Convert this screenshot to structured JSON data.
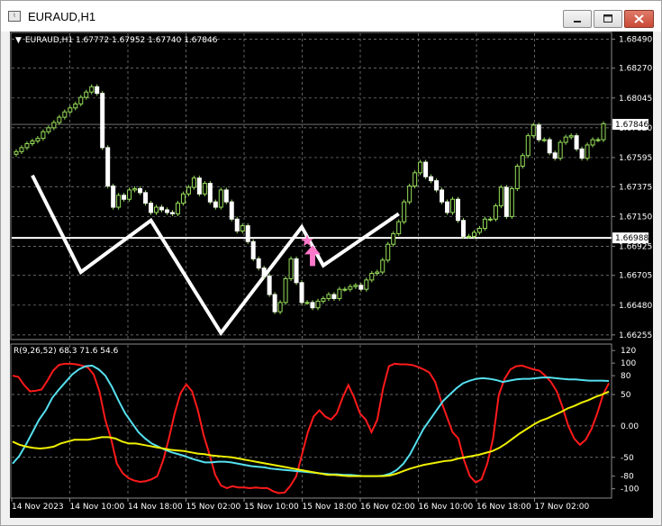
{
  "window": {
    "title": "EURAUD,H1",
    "icon": "mt4-chart-icon"
  },
  "titlebar_buttons": {
    "minimize": "minimize-icon",
    "maximize": "maximize-icon",
    "close": "close-icon"
  },
  "chart_header": {
    "marker": "▼",
    "text": "EURAUD,H1  1.67772 1.67952 1.67740 1.67846"
  },
  "indicator_header": {
    "text": "R(9,26,52) 68.3 71.6 54.6"
  },
  "colors": {
    "background": "#000000",
    "grid": "#8a8a8a",
    "candle": "#98e05a",
    "axis_text": "#ffffff",
    "pattern": "#ffffff",
    "red_line": "#ff1a1a",
    "cyan_line": "#55e0ee",
    "yellow_line": "#f0f000",
    "marker": "#ff77c8"
  },
  "chart_data": [
    {
      "type": "candlestick",
      "symbol": "EURAUD",
      "timeframe": "H1",
      "ohlc_last": {
        "open": 1.67772,
        "high": 1.67952,
        "low": 1.6774,
        "close": 1.67846
      },
      "y_ticks": [
        "1.68490",
        "1.68270",
        "1.68045",
        "1.67820",
        "1.67595",
        "1.67375",
        "1.67150",
        "1.66925",
        "1.66705",
        "1.66480",
        "1.66255"
      ],
      "ylim": [
        1.6622,
        1.6852
      ],
      "price_labels": [
        {
          "text": "1.67846",
          "value": 1.67846
        },
        {
          "text": "1.66988",
          "value": 1.66988
        }
      ],
      "horizontal_line": 1.66988,
      "x_ticks": [
        "14 Nov 2023",
        "14 Nov 10:00",
        "14 Nov 18:00",
        "15 Nov 02:00",
        "15 Nov 10:00",
        "15 Nov 18:00",
        "16 Nov 02:00",
        "16 Nov 10:00",
        "16 Nov 18:00",
        "17 Nov 02:00"
      ],
      "closes": [
        1.6764,
        1.6767,
        1.677,
        1.6772,
        1.6774,
        1.6779,
        1.6782,
        1.6786,
        1.679,
        1.6794,
        1.6797,
        1.68,
        1.6805,
        1.6809,
        1.6813,
        1.6808,
        1.6767,
        1.6738,
        1.6722,
        1.6731,
        1.6728,
        1.6735,
        1.6736,
        1.6733,
        1.6725,
        1.6718,
        1.6722,
        1.672,
        1.6718,
        1.6717,
        1.6725,
        1.6732,
        1.6737,
        1.6744,
        1.6732,
        1.674,
        1.6726,
        1.6722,
        1.6735,
        1.6726,
        1.6713,
        1.6704,
        1.6708,
        1.6696,
        1.6683,
        1.6676,
        1.667,
        1.6656,
        1.6643,
        1.665,
        1.6668,
        1.6683,
        1.6665,
        1.665,
        1.665,
        1.6646,
        1.6651,
        1.6653,
        1.6656,
        1.6653,
        1.666,
        1.666,
        1.6662,
        1.6663,
        1.666,
        1.6667,
        1.6672,
        1.6673,
        1.6682,
        1.6694,
        1.6702,
        1.6711,
        1.6726,
        1.6738,
        1.6748,
        1.6756,
        1.6745,
        1.6742,
        1.6735,
        1.6726,
        1.6718,
        1.6728,
        1.6712,
        1.67,
        1.67,
        1.6703,
        1.6706,
        1.6713,
        1.6713,
        1.6723,
        1.6737,
        1.6715,
        1.6736,
        1.6753,
        1.6761,
        1.6776,
        1.6784,
        1.6773,
        1.6773,
        1.6763,
        1.6759,
        1.6771,
        1.6775,
        1.6776,
        1.6766,
        1.6759,
        1.6769,
        1.6773,
        1.6773,
        1.6785
      ],
      "pattern_points": [
        [
          3,
          1.6746
        ],
        [
          12,
          1.6673
        ],
        [
          25,
          1.6712
        ],
        [
          38,
          1.6627
        ],
        [
          53,
          1.6707
        ],
        [
          57,
          1.6678
        ],
        [
          71,
          1.6717
        ]
      ],
      "markers": [
        {
          "type": "star",
          "index": 54,
          "value": 1.66965
        },
        {
          "type": "up-arrow",
          "index": 55,
          "value": 1.6685
        }
      ]
    },
    {
      "type": "line",
      "title": "R(9,26,52)",
      "last_values": [
        68.3,
        71.6,
        54.6
      ],
      "y_ticks": [
        "120",
        "100",
        "80",
        "50",
        "0.00",
        "-50",
        "-80",
        "-100"
      ],
      "ylim": [
        -112,
        126
      ],
      "series": [
        {
          "color": "#ff1a1a",
          "values": [
            80,
            78,
            65,
            55,
            56,
            58,
            72,
            88,
            97,
            99,
            99,
            98,
            96,
            93,
            82,
            55,
            10,
            -20,
            -60,
            -75,
            -83,
            -87,
            -89,
            -88,
            -85,
            -80,
            -55,
            -20,
            20,
            52,
            66,
            55,
            25,
            -15,
            -45,
            -78,
            -95,
            -99,
            -96,
            -98,
            -98,
            -99,
            -98,
            -99,
            -99,
            -104,
            -107,
            -106,
            -95,
            -80,
            -45,
            -10,
            15,
            25,
            15,
            10,
            20,
            45,
            65,
            45,
            20,
            10,
            -10,
            10,
            60,
            95,
            99,
            98,
            98,
            97,
            94,
            90,
            85,
            70,
            40,
            15,
            -10,
            -20,
            -55,
            -80,
            -90,
            -85,
            -60,
            -20,
            50,
            75,
            90,
            95,
            96,
            93,
            90,
            88,
            80,
            70,
            55,
            30,
            0,
            -20,
            -30,
            -22,
            -5,
            20,
            50,
            68
          ]
        },
        {
          "color": "#55e0ee",
          "values": [
            -60,
            -48,
            -30,
            -10,
            10,
            25,
            45,
            58,
            70,
            82,
            90,
            95,
            96,
            90,
            80,
            62,
            40,
            20,
            5,
            -10,
            -20,
            -28,
            -33,
            -38,
            -42,
            -45,
            -48,
            -52,
            -55,
            -58,
            -58,
            -57,
            -57,
            -58,
            -60,
            -62,
            -64,
            -65,
            -66,
            -68,
            -69,
            -70,
            -71,
            -72,
            -73,
            -74,
            -75,
            -76,
            -77,
            -77,
            -78,
            -78,
            -79,
            -80,
            -80,
            -80,
            -79,
            -76,
            -70,
            -60,
            -45,
            -25,
            -5,
            10,
            25,
            40,
            50,
            60,
            68,
            72,
            75,
            76,
            75,
            73,
            70,
            72,
            74,
            75,
            75,
            76,
            77,
            77,
            76,
            75,
            74,
            74,
            73,
            72,
            72,
            72,
            71.6
          ]
        },
        {
          "color": "#f0f000",
          "values": [
            -25,
            -30,
            -33,
            -35,
            -36,
            -35,
            -33,
            -28,
            -25,
            -22,
            -22,
            -22,
            -20,
            -18,
            -18,
            -20,
            -25,
            -28,
            -28,
            -30,
            -32,
            -34,
            -36,
            -38,
            -39,
            -40,
            -42,
            -44,
            -45,
            -47,
            -48,
            -49,
            -50,
            -52,
            -54,
            -56,
            -58,
            -60,
            -62,
            -64,
            -66,
            -68,
            -70,
            -72,
            -74,
            -76,
            -78,
            -78,
            -79,
            -80,
            -80,
            -80,
            -80,
            -80,
            -80,
            -79,
            -76,
            -72,
            -68,
            -65,
            -62,
            -60,
            -58,
            -56,
            -55,
            -52,
            -50,
            -48,
            -46,
            -43,
            -40,
            -35,
            -28,
            -20,
            -12,
            -5,
            2,
            8,
            12,
            17,
            22,
            28,
            32,
            37,
            41,
            46,
            50,
            54.6
          ]
        }
      ]
    }
  ]
}
